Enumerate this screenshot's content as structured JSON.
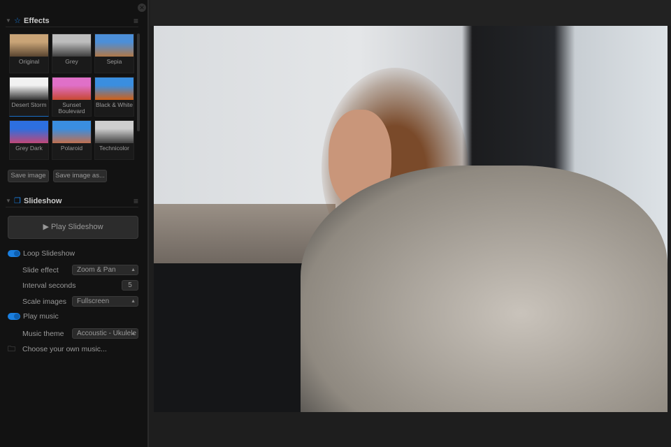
{
  "effects": {
    "title": "Effects",
    "items": [
      {
        "label": "Original",
        "colors": [
          "#c9a477",
          "#5a4530"
        ]
      },
      {
        "label": "Grey",
        "colors": [
          "#bdbdbd",
          "#3e3e3e"
        ]
      },
      {
        "label": "Sepia",
        "colors": [
          "#4c8fd8",
          "#b07848"
        ]
      },
      {
        "label": "Desert Storm",
        "colors": [
          "#f2f2f2",
          "#333333"
        ],
        "selected": true
      },
      {
        "label": "Sunset Boulevard",
        "colors": [
          "#e070c8",
          "#c84830"
        ]
      },
      {
        "label": "Black & White",
        "colors": [
          "#3a8ee0",
          "#d06018"
        ]
      },
      {
        "label": "Grey Dark",
        "colors": [
          "#2d6fe0",
          "#c04878"
        ]
      },
      {
        "label": "Polaroid",
        "colors": [
          "#3a8ee0",
          "#c07050"
        ]
      },
      {
        "label": "Technicolor",
        "colors": [
          "#cfcfcf",
          "#404040"
        ]
      }
    ],
    "save_image": "Save image",
    "save_image_as": "Save image as..."
  },
  "slideshow": {
    "title": "Slideshow",
    "play": "Play Slideshow",
    "loop": "Loop Slideshow",
    "slide_effect_label": "Slide effect",
    "slide_effect": "Zoom & Pan",
    "interval_label": "Interval seconds",
    "interval": "5",
    "scale_label": "Scale images",
    "scale": "Fullscreen",
    "play_music": "Play music",
    "music_theme_label": "Music theme",
    "music_theme": "Accoustic - Ukulele",
    "choose_music": "Choose your own music..."
  }
}
